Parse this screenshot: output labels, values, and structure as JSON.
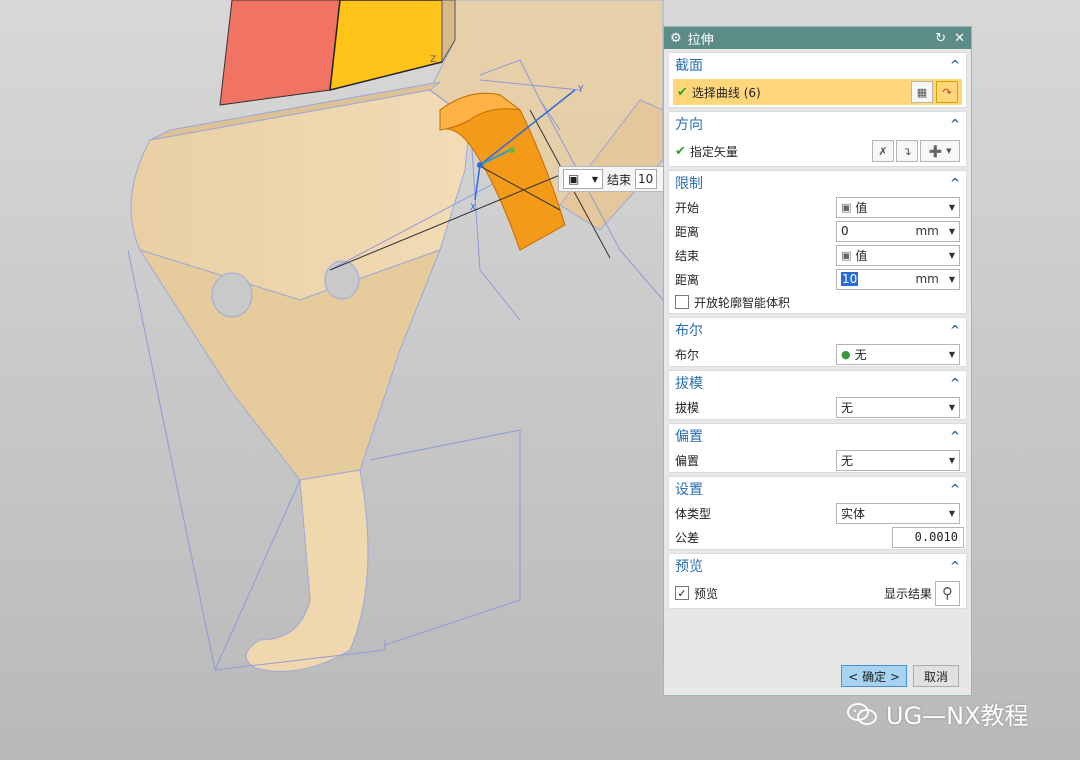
{
  "colors": {
    "dialog_title_bg": "#5c8c88",
    "section_header": "#2a6fb0",
    "selection_bg": "#ffd77a",
    "part_tan": "#e7c99a",
    "extrude_orange": "#f39a19",
    "face_red": "#f07364",
    "face_yellow": "#ffc31a"
  },
  "canvas": {
    "float_widget": {
      "label": "结束",
      "value": "10",
      "icon": "cube-icon"
    },
    "axis_y_label": "Y",
    "axis_x_label": "X",
    "axis_z_label": "Z"
  },
  "dialog": {
    "title": "拉伸",
    "title_icon": "gear-icon",
    "reset_icon": "reset-icon",
    "close_icon": "close-icon",
    "section": {
      "header": "截面",
      "select_label": "选择曲线 (6)"
    },
    "direction": {
      "header": "方向",
      "vector_label": "指定矢量"
    },
    "limits": {
      "header": "限制",
      "start_label": "开始",
      "start_value": "值",
      "start_distance_label": "距离",
      "start_distance": "0",
      "start_unit": "mm",
      "end_label": "结束",
      "end_value": "值",
      "end_distance_label": "距离",
      "end_distance": "10",
      "end_unit": "mm",
      "open_profile_label": "开放轮廓智能体积"
    },
    "boolean": {
      "header": "布尔",
      "label": "布尔",
      "value": "无"
    },
    "draft": {
      "header": "拔模",
      "label": "拔模",
      "value": "无"
    },
    "offset": {
      "header": "偏置",
      "label": "偏置",
      "value": "无"
    },
    "settings": {
      "header": "设置",
      "body_type_label": "体类型",
      "body_type_value": "实体",
      "tolerance_label": "公差",
      "tolerance_value": "0.0010"
    },
    "preview": {
      "header": "预览",
      "preview_label": "预览",
      "show_result_label": "显示结果"
    },
    "ok_label": "< 确定 >",
    "cancel_label": "取消"
  },
  "watermark": "UG—NX教程"
}
